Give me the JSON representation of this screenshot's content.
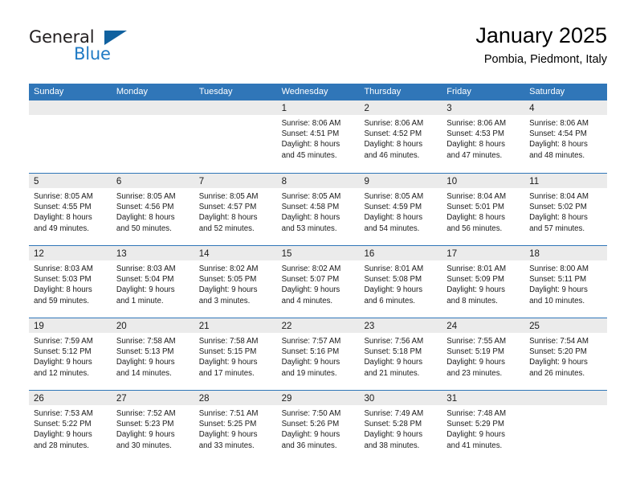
{
  "brand": {
    "name_part1": "General",
    "name_part2": "Blue",
    "triangle_color": "#10619f",
    "blue_color": "#1f7ac4"
  },
  "header": {
    "title": "January 2025",
    "location": "Pombia, Piedmont, Italy"
  },
  "colors": {
    "header_blue": "#3076b8",
    "date_band": "#ebebeb",
    "text": "#1a1a1a"
  },
  "weekdays": [
    "Sunday",
    "Monday",
    "Tuesday",
    "Wednesday",
    "Thursday",
    "Friday",
    "Saturday"
  ],
  "weeks": [
    [
      {
        "day": "",
        "sunrise": "",
        "sunset": "",
        "daylight1": "",
        "daylight2": ""
      },
      {
        "day": "",
        "sunrise": "",
        "sunset": "",
        "daylight1": "",
        "daylight2": ""
      },
      {
        "day": "",
        "sunrise": "",
        "sunset": "",
        "daylight1": "",
        "daylight2": ""
      },
      {
        "day": "1",
        "sunrise": "Sunrise: 8:06 AM",
        "sunset": "Sunset: 4:51 PM",
        "daylight1": "Daylight: 8 hours",
        "daylight2": "and 45 minutes."
      },
      {
        "day": "2",
        "sunrise": "Sunrise: 8:06 AM",
        "sunset": "Sunset: 4:52 PM",
        "daylight1": "Daylight: 8 hours",
        "daylight2": "and 46 minutes."
      },
      {
        "day": "3",
        "sunrise": "Sunrise: 8:06 AM",
        "sunset": "Sunset: 4:53 PM",
        "daylight1": "Daylight: 8 hours",
        "daylight2": "and 47 minutes."
      },
      {
        "day": "4",
        "sunrise": "Sunrise: 8:06 AM",
        "sunset": "Sunset: 4:54 PM",
        "daylight1": "Daylight: 8 hours",
        "daylight2": "and 48 minutes."
      }
    ],
    [
      {
        "day": "5",
        "sunrise": "Sunrise: 8:05 AM",
        "sunset": "Sunset: 4:55 PM",
        "daylight1": "Daylight: 8 hours",
        "daylight2": "and 49 minutes."
      },
      {
        "day": "6",
        "sunrise": "Sunrise: 8:05 AM",
        "sunset": "Sunset: 4:56 PM",
        "daylight1": "Daylight: 8 hours",
        "daylight2": "and 50 minutes."
      },
      {
        "day": "7",
        "sunrise": "Sunrise: 8:05 AM",
        "sunset": "Sunset: 4:57 PM",
        "daylight1": "Daylight: 8 hours",
        "daylight2": "and 52 minutes."
      },
      {
        "day": "8",
        "sunrise": "Sunrise: 8:05 AM",
        "sunset": "Sunset: 4:58 PM",
        "daylight1": "Daylight: 8 hours",
        "daylight2": "and 53 minutes."
      },
      {
        "day": "9",
        "sunrise": "Sunrise: 8:05 AM",
        "sunset": "Sunset: 4:59 PM",
        "daylight1": "Daylight: 8 hours",
        "daylight2": "and 54 minutes."
      },
      {
        "day": "10",
        "sunrise": "Sunrise: 8:04 AM",
        "sunset": "Sunset: 5:01 PM",
        "daylight1": "Daylight: 8 hours",
        "daylight2": "and 56 minutes."
      },
      {
        "day": "11",
        "sunrise": "Sunrise: 8:04 AM",
        "sunset": "Sunset: 5:02 PM",
        "daylight1": "Daylight: 8 hours",
        "daylight2": "and 57 minutes."
      }
    ],
    [
      {
        "day": "12",
        "sunrise": "Sunrise: 8:03 AM",
        "sunset": "Sunset: 5:03 PM",
        "daylight1": "Daylight: 8 hours",
        "daylight2": "and 59 minutes."
      },
      {
        "day": "13",
        "sunrise": "Sunrise: 8:03 AM",
        "sunset": "Sunset: 5:04 PM",
        "daylight1": "Daylight: 9 hours",
        "daylight2": "and 1 minute."
      },
      {
        "day": "14",
        "sunrise": "Sunrise: 8:02 AM",
        "sunset": "Sunset: 5:05 PM",
        "daylight1": "Daylight: 9 hours",
        "daylight2": "and 3 minutes."
      },
      {
        "day": "15",
        "sunrise": "Sunrise: 8:02 AM",
        "sunset": "Sunset: 5:07 PM",
        "daylight1": "Daylight: 9 hours",
        "daylight2": "and 4 minutes."
      },
      {
        "day": "16",
        "sunrise": "Sunrise: 8:01 AM",
        "sunset": "Sunset: 5:08 PM",
        "daylight1": "Daylight: 9 hours",
        "daylight2": "and 6 minutes."
      },
      {
        "day": "17",
        "sunrise": "Sunrise: 8:01 AM",
        "sunset": "Sunset: 5:09 PM",
        "daylight1": "Daylight: 9 hours",
        "daylight2": "and 8 minutes."
      },
      {
        "day": "18",
        "sunrise": "Sunrise: 8:00 AM",
        "sunset": "Sunset: 5:11 PM",
        "daylight1": "Daylight: 9 hours",
        "daylight2": "and 10 minutes."
      }
    ],
    [
      {
        "day": "19",
        "sunrise": "Sunrise: 7:59 AM",
        "sunset": "Sunset: 5:12 PM",
        "daylight1": "Daylight: 9 hours",
        "daylight2": "and 12 minutes."
      },
      {
        "day": "20",
        "sunrise": "Sunrise: 7:58 AM",
        "sunset": "Sunset: 5:13 PM",
        "daylight1": "Daylight: 9 hours",
        "daylight2": "and 14 minutes."
      },
      {
        "day": "21",
        "sunrise": "Sunrise: 7:58 AM",
        "sunset": "Sunset: 5:15 PM",
        "daylight1": "Daylight: 9 hours",
        "daylight2": "and 17 minutes."
      },
      {
        "day": "22",
        "sunrise": "Sunrise: 7:57 AM",
        "sunset": "Sunset: 5:16 PM",
        "daylight1": "Daylight: 9 hours",
        "daylight2": "and 19 minutes."
      },
      {
        "day": "23",
        "sunrise": "Sunrise: 7:56 AM",
        "sunset": "Sunset: 5:18 PM",
        "daylight1": "Daylight: 9 hours",
        "daylight2": "and 21 minutes."
      },
      {
        "day": "24",
        "sunrise": "Sunrise: 7:55 AM",
        "sunset": "Sunset: 5:19 PM",
        "daylight1": "Daylight: 9 hours",
        "daylight2": "and 23 minutes."
      },
      {
        "day": "25",
        "sunrise": "Sunrise: 7:54 AM",
        "sunset": "Sunset: 5:20 PM",
        "daylight1": "Daylight: 9 hours",
        "daylight2": "and 26 minutes."
      }
    ],
    [
      {
        "day": "26",
        "sunrise": "Sunrise: 7:53 AM",
        "sunset": "Sunset: 5:22 PM",
        "daylight1": "Daylight: 9 hours",
        "daylight2": "and 28 minutes."
      },
      {
        "day": "27",
        "sunrise": "Sunrise: 7:52 AM",
        "sunset": "Sunset: 5:23 PM",
        "daylight1": "Daylight: 9 hours",
        "daylight2": "and 30 minutes."
      },
      {
        "day": "28",
        "sunrise": "Sunrise: 7:51 AM",
        "sunset": "Sunset: 5:25 PM",
        "daylight1": "Daylight: 9 hours",
        "daylight2": "and 33 minutes."
      },
      {
        "day": "29",
        "sunrise": "Sunrise: 7:50 AM",
        "sunset": "Sunset: 5:26 PM",
        "daylight1": "Daylight: 9 hours",
        "daylight2": "and 36 minutes."
      },
      {
        "day": "30",
        "sunrise": "Sunrise: 7:49 AM",
        "sunset": "Sunset: 5:28 PM",
        "daylight1": "Daylight: 9 hours",
        "daylight2": "and 38 minutes."
      },
      {
        "day": "31",
        "sunrise": "Sunrise: 7:48 AM",
        "sunset": "Sunset: 5:29 PM",
        "daylight1": "Daylight: 9 hours",
        "daylight2": "and 41 minutes."
      },
      {
        "day": "",
        "sunrise": "",
        "sunset": "",
        "daylight1": "",
        "daylight2": ""
      }
    ]
  ]
}
